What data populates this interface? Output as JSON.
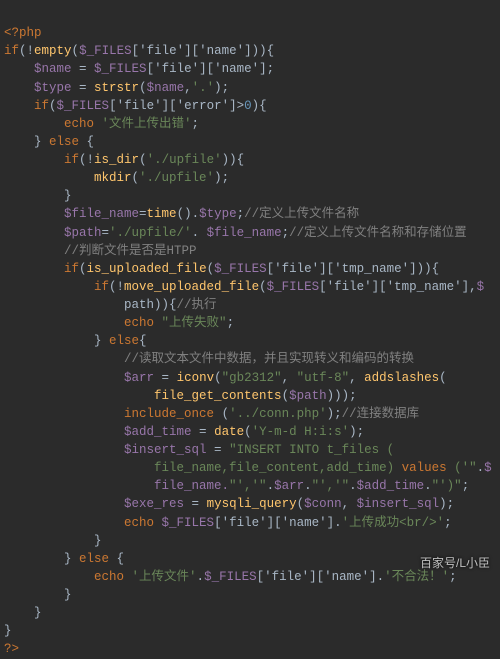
{
  "l1": "<?php",
  "l2": {
    "a": "if",
    "b": "(!",
    "c": "empty",
    "d": "(",
    "e": "$_FILES",
    "f": "['file']['name'])){"
  },
  "l3": {
    "a": "    ",
    "b": "$name",
    "c": " = ",
    "d": "$_FILES",
    "e": "['file']['name'];"
  },
  "l4": {
    "a": "    ",
    "b": "$type",
    "c": " = ",
    "d": "strstr",
    "e": "(",
    "f": "$name",
    "g": ",",
    "h": "'.'",
    "i": ");"
  },
  "l5": {
    "a": "    ",
    "b": "if",
    "c": "(",
    "d": "$_FILES",
    "e": "['file']['error']",
    "f": ">",
    "g": "0",
    "h": "){"
  },
  "l6": {
    "a": "        ",
    "b": "echo ",
    "c": "'文件上传出错'",
    "d": ";"
  },
  "l7": {
    "a": "    } ",
    "b": "else ",
    "c": "{"
  },
  "l8": {
    "a": "        ",
    "b": "if",
    "c": "(!",
    "d": "is_dir",
    "e": "(",
    "f": "'./upfile'",
    "g": ")){"
  },
  "l9": {
    "a": "            ",
    "b": "mkdir",
    "c": "(",
    "d": "'./upfile'",
    "e": ");"
  },
  "l10": "        }",
  "l11": {
    "a": "        ",
    "b": "$file_name",
    "c": "=",
    "d": "time",
    "e": "().",
    "f": "$type",
    "g": ";",
    "h": "//定义上传文件名称"
  },
  "l12": {
    "a": "        ",
    "b": "$path",
    "c": "=",
    "d": "'./upfile/'",
    "e": ". ",
    "f": "$file_name",
    "g": ";",
    "h": "//定义上传文件名称和存储位置"
  },
  "l13": {
    "a": "        ",
    "b": "//判断文件是否是HTPP"
  },
  "l14": {
    "a": "        ",
    "b": "if",
    "c": "(",
    "d": "is_uploaded_file",
    "e": "(",
    "f": "$_FILES",
    "g": "['file']['tmp_name'])){"
  },
  "l15": {
    "a": "            ",
    "b": "if",
    "c": "(!",
    "d": "move_uploaded_file",
    "e": "(",
    "f": "$_FILES",
    "g": "['file']['tmp_name'],",
    "h": "$"
  },
  "l16": {
    "a": "                ",
    "b": "path)){",
    "c": "//执行"
  },
  "l17": {
    "a": "                ",
    "b": "echo ",
    "c": "\"上传失败\"",
    "d": ";"
  },
  "l18": {
    "a": "            } ",
    "b": "else",
    "c": "{"
  },
  "l19": {
    "a": "                ",
    "b": "//读取文本文件中数据，并且实现转义和编码的转换"
  },
  "l20": {
    "a": "                ",
    "b": "$arr",
    "c": " = ",
    "d": "iconv",
    "e": "(",
    "f": "\"gb2312\"",
    "g": ", ",
    "h": "\"utf-8\"",
    "i": ", ",
    "j": "addslashes",
    "k": "("
  },
  "l21": {
    "a": "                    ",
    "b": "file_get_contents",
    "c": "(",
    "d": "$path",
    "e": ")));"
  },
  "l22": {
    "a": "                ",
    "b": "include_once ",
    "c": "(",
    "d": "'../conn.php'",
    "e": ");",
    "f": "//连接数据库"
  },
  "l23": {
    "a": "                ",
    "b": "$add_time",
    "c": " = ",
    "d": "date",
    "e": "(",
    "f": "'Y-m-d H:i:s'",
    "g": ");"
  },
  "l24": {
    "a": "                ",
    "b": "$insert_sql",
    "c": " = ",
    "d": "\"INSERT INTO t_files ("
  },
  "l25": {
    "a": "                    ",
    "b": "file_name,file_content,add_time)",
    "c": " values ",
    "d": "('\"",
    "e": ".",
    "f": "$"
  },
  "l26": {
    "a": "                    ",
    "b": "file_name.",
    "c": "\"','\"",
    "d": ".",
    "e": "$arr",
    "f": ".",
    "g": "\"','\"",
    "h": ".",
    "i": "$add_time",
    "j": ".",
    "k": "\"')\"",
    "l": ";"
  },
  "l27": {
    "a": "                ",
    "b": "$exe_res",
    "c": " = ",
    "d": "mysqli_query",
    "e": "(",
    "f": "$conn",
    "g": ", ",
    "h": "$insert_sql",
    "i": ");"
  },
  "l28": {
    "a": "                ",
    "b": "echo ",
    "c": "$_FILES",
    "d": "['file']['name'].",
    "e": "'上传成功<br/>'",
    "f": ";"
  },
  "l29": "            }",
  "l30": {
    "a": "        } ",
    "b": "else ",
    "c": "{"
  },
  "l31": {
    "a": "            ",
    "b": "echo ",
    "c": "'上传文件'",
    "d": ".",
    "e": "$_FILES",
    "f": "['file']['name'].",
    "g": "'不合法！'",
    "h": ";"
  },
  "l32": "        }",
  "l33": "    }",
  "l34": "}",
  "l35": "?>",
  "watermark": "百家号/L小臣"
}
